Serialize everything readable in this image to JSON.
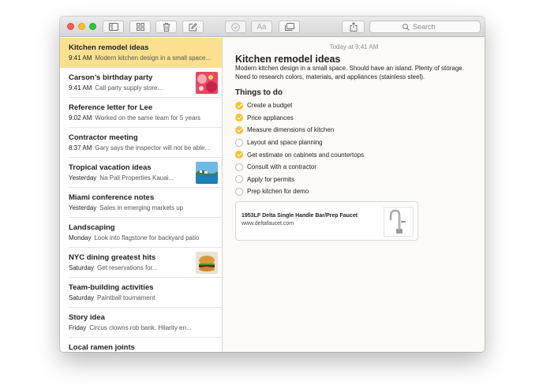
{
  "toolbar": {
    "buttons": [
      {
        "name": "sidebar-toggle",
        "icon": "sidebar-icon"
      },
      {
        "name": "gallery-view",
        "icon": "grid-icon"
      },
      {
        "name": "delete",
        "icon": "trash-icon"
      },
      {
        "name": "new-note",
        "icon": "compose-icon"
      },
      {
        "name": "checklist",
        "icon": "checkmark-circle-icon"
      },
      {
        "name": "format",
        "icon": "format-aa-icon",
        "label": "Aa"
      },
      {
        "name": "attachments",
        "icon": "window-icon"
      },
      {
        "name": "share",
        "icon": "share-icon"
      }
    ],
    "search_placeholder": "Search"
  },
  "notes": [
    {
      "title": "Kitchen remodel ideas",
      "date": "9:41 AM",
      "preview": "Modern kitchen design in a small space...",
      "selected": true
    },
    {
      "title": "Carson’s birthday party",
      "date": "9:41 AM",
      "preview": "Call party supply store...",
      "thumbnail": "party-photo"
    },
    {
      "title": "Reference letter for Lee",
      "date": "9:02 AM",
      "preview": "Worked on the same team for 5 years"
    },
    {
      "title": "Contractor meeting",
      "date": "8:37 AM",
      "preview": "Gary says the inspector will not be able..."
    },
    {
      "title": "Tropical vacation ideas",
      "date": "Yesterday",
      "preview": "Na Pali Properties Kauai...",
      "thumbnail": "beach-photo"
    },
    {
      "title": "Miami conference notes",
      "date": "Yesterday",
      "preview": "Sales in emerging markets up"
    },
    {
      "title": "Landscaping",
      "date": "Monday",
      "preview": "Look into flagstone for backyard patio"
    },
    {
      "title": "NYC dining greatest hits",
      "date": "Saturday",
      "preview": "Get reservations for...",
      "thumbnail": "burger-photo"
    },
    {
      "title": "Team-building activities",
      "date": "Saturday",
      "preview": "Paintball tournament"
    },
    {
      "title": "Story idea",
      "date": "Friday",
      "preview": "Circus clowns rob bank. Hilarity en..."
    },
    {
      "title": "Local ramen joints",
      "date": "",
      "preview": ""
    }
  ],
  "editor": {
    "date": "Today at 9:41 AM",
    "title": "Kitchen remodel ideas",
    "body": "Modern kitchen design in a small space. Should have an island.  Plenty of storage. Need to research colors, materials, and appliances (stainless steel).",
    "checklist_heading": "Things to do",
    "checklist": [
      {
        "text": "Create a budget",
        "checked": true
      },
      {
        "text": "Price appliances",
        "checked": true
      },
      {
        "text": "Measure dimensions of kitchen",
        "checked": true
      },
      {
        "text": "Layout and space planning",
        "checked": false
      },
      {
        "text": "Get estimate on cabinets and countertops",
        "checked": true
      },
      {
        "text": "Consult with a contractor",
        "checked": false
      },
      {
        "text": "Apply for permits",
        "checked": false
      },
      {
        "text": "Prep kitchen for demo",
        "checked": false
      }
    ],
    "link": {
      "title": "1953LF Delta Single Handle Bar/Prep Faucet",
      "url": "www.deltafaucet.com",
      "thumbnail": "faucet-image"
    }
  },
  "colors": {
    "selection": "#fbe08f",
    "check": "#f7c132"
  }
}
